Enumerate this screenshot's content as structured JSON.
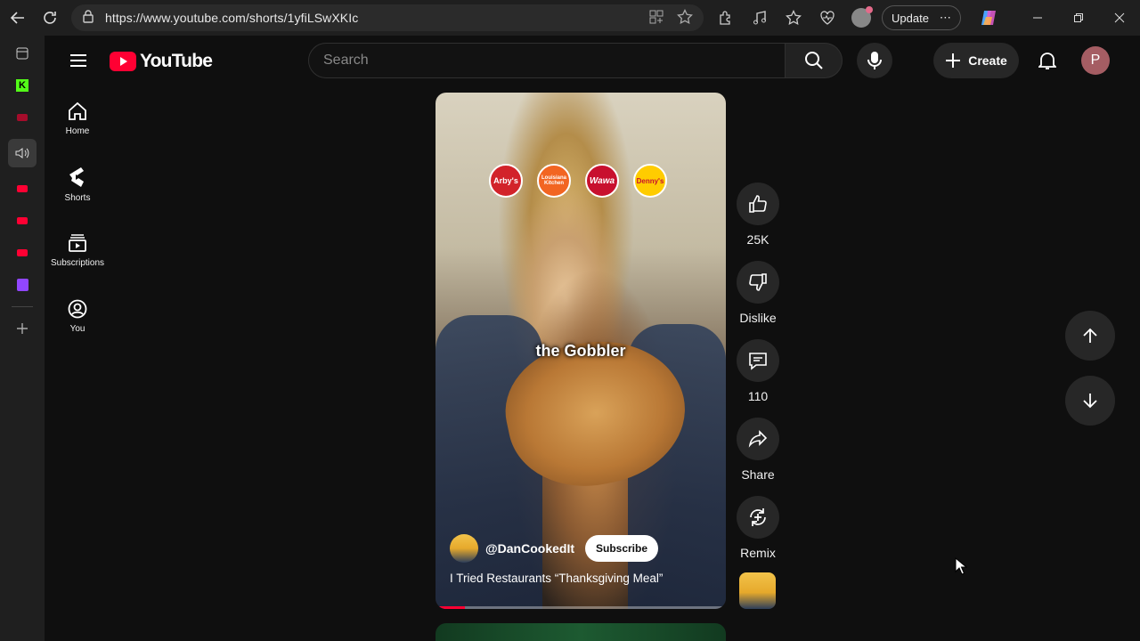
{
  "browser": {
    "url": "https://www.youtube.com/shorts/1yfiLSwXKIc",
    "update_label": "Update"
  },
  "header": {
    "logo_text": "YouTube",
    "search_placeholder": "Search",
    "create_label": "Create",
    "avatar_letter": "P"
  },
  "guide": {
    "items": [
      {
        "label": "Home",
        "icon": "home-icon"
      },
      {
        "label": "Shorts",
        "icon": "shorts-icon"
      },
      {
        "label": "Subscriptions",
        "icon": "subscriptions-icon"
      },
      {
        "label": "You",
        "icon": "you-icon"
      }
    ]
  },
  "short": {
    "caption": "the Gobbler",
    "restaurant_logos": [
      "Arby's",
      "Louisiana Kitchen",
      "Wawa",
      "Denny's"
    ],
    "channel": "@DanCookedIt",
    "subscribe_label": "Subscribe",
    "title": "I Tried Restaurants “Thanksgiving Meal”",
    "progress": 0.1
  },
  "actions": {
    "like": "25K",
    "dislike": "Dislike",
    "comments": "110",
    "share": "Share",
    "remix": "Remix"
  },
  "colors": {
    "background": "#0f0f0f",
    "brand_red": "#ff0033",
    "button_bg": "#272727",
    "avatar_bg": "#a55d63"
  }
}
